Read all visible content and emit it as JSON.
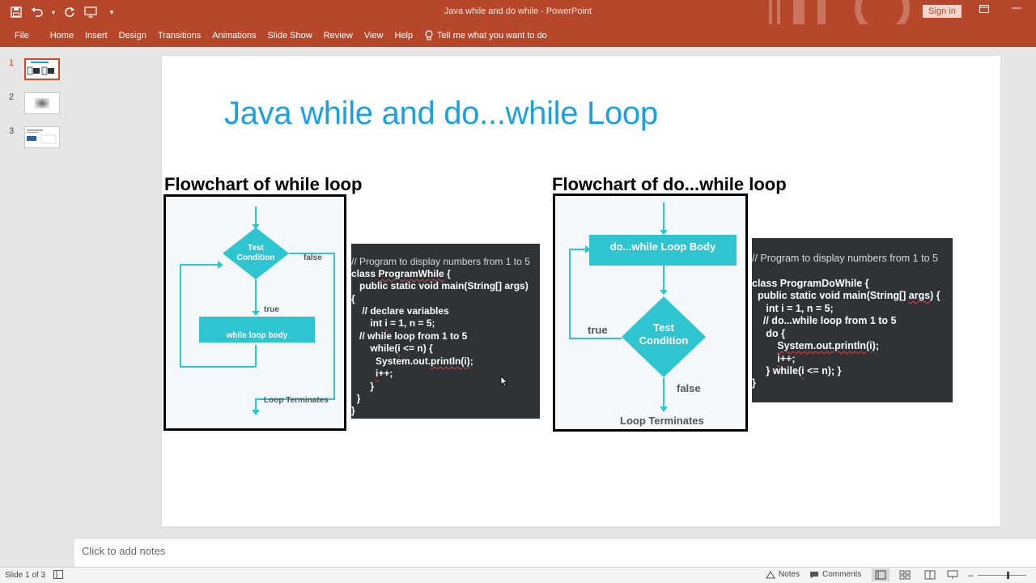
{
  "app": {
    "window_title": "Java while and do while  -  PowerPoint",
    "sign_in": "Sign in"
  },
  "ribbon": {
    "tabs": [
      "File",
      "Home",
      "Insert",
      "Design",
      "Transitions",
      "Animations",
      "Slide Show",
      "Review",
      "View",
      "Help"
    ],
    "tell_me": "Tell me what you want to do"
  },
  "thumbnails": [
    {
      "number": "1",
      "active": true
    },
    {
      "number": "2",
      "active": false
    },
    {
      "number": "3",
      "active": false
    }
  ],
  "slide": {
    "title": "Java while and do...while Loop",
    "left": {
      "heading": "Flowchart of while loop",
      "flowchart": {
        "test": [
          "Test",
          "Condition"
        ],
        "false_label": "false",
        "true_label": "true",
        "body": "while loop body",
        "end": "Loop Terminates"
      },
      "code": [
        {
          "text": "// Program to display numbers from 1 to 5",
          "comment": true
        },
        {
          "text": "class ProgramWhile {"
        },
        {
          "text": "   public static void main(String[] args)"
        },
        {
          "text": "{"
        },
        {
          "text": "    // declare variables"
        },
        {
          "text": "       int i = 1, n = 5;"
        },
        {
          "text": "   // while loop from 1 to 5"
        },
        {
          "text": "       while(i <= n) {"
        },
        {
          "text": "         System.out.println(i);"
        },
        {
          "text": "         i++;"
        },
        {
          "text": "       }"
        },
        {
          "text": "  }"
        },
        {
          "text": "}"
        }
      ]
    },
    "right": {
      "heading": "Flowchart of do...while loop",
      "flowchart": {
        "body": "do...while Loop Body",
        "test": [
          "Test",
          "Condition"
        ],
        "true_label": "true",
        "false_label": "false",
        "end": "Loop Terminates"
      },
      "code": [
        {
          "text": "// Program to display numbers from 1 to 5",
          "comment": true
        },
        {
          "text": ""
        },
        {
          "text": "class ProgramDoWhile {"
        },
        {
          "text": "  public static void main(String[] args) {"
        },
        {
          "text": "     int i = 1, n = 5;"
        },
        {
          "text": "    // do...while loop from 1 to 5"
        },
        {
          "text": "     do {"
        },
        {
          "text": "         System.out.println(i);"
        },
        {
          "text": "         i++;"
        },
        {
          "text": "     } while(i <= n); }"
        },
        {
          "text": "}"
        }
      ]
    }
  },
  "notes_placeholder": "Click to add notes",
  "status": {
    "slide_counter": "Slide 1 of 3",
    "notes": "Notes",
    "comments": "Comments"
  },
  "colors": {
    "accent": "#b7472a",
    "title_blue": "#1ba1e2",
    "teal": "#2ec4d0",
    "code_bg": "#2f3335"
  }
}
